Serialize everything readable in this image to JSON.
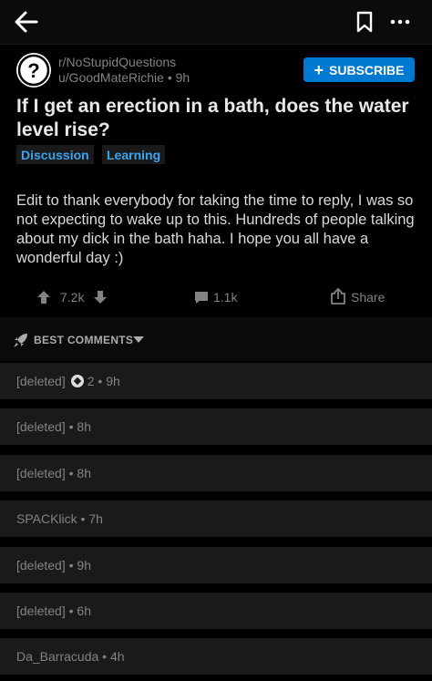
{
  "post": {
    "subreddit": "r/NoStupidQuestions",
    "author": "u/GoodMateRichie",
    "age": "9h",
    "title": "If I get an erection in a bath, does the water level rise?",
    "flairs": [
      "Discussion",
      "Learning"
    ],
    "body": "Edit to thank everybody for taking the time to reply, I was so not expecting to wake up to this. Hundreds of people talking about my dick in the bath haha. I hope you all have a wonderful day :)",
    "votes": "7.2k",
    "comments": "1.1k",
    "share_label": "Share"
  },
  "subscribe_label": "SUBSCRIBE",
  "sort_label": "BEST COMMENTS",
  "comment_list": [
    {
      "author": "[deleted]",
      "award_count": "2",
      "age": "9h"
    },
    {
      "author": "[deleted]",
      "age": "8h"
    },
    {
      "author": "[deleted]",
      "age": "8h"
    },
    {
      "author": "SPACKlick",
      "age": "7h"
    },
    {
      "author": "[deleted]",
      "age": "9h"
    },
    {
      "author": "[deleted]",
      "age": "6h"
    },
    {
      "author": "Da_Barracuda",
      "age": "4h"
    }
  ],
  "colors": {
    "accent": "#0079d3",
    "flair_text": "#3aa4f0",
    "background": "#000000",
    "card": "#1a1a1b",
    "muted_text": "#818384"
  },
  "icons": [
    "back-arrow-icon",
    "bookmark-icon",
    "more-icon",
    "question-mark-icon",
    "upvote-icon",
    "downvote-icon",
    "comment-icon",
    "share-icon",
    "rocket-icon",
    "caret-down-icon",
    "award-icon"
  ]
}
